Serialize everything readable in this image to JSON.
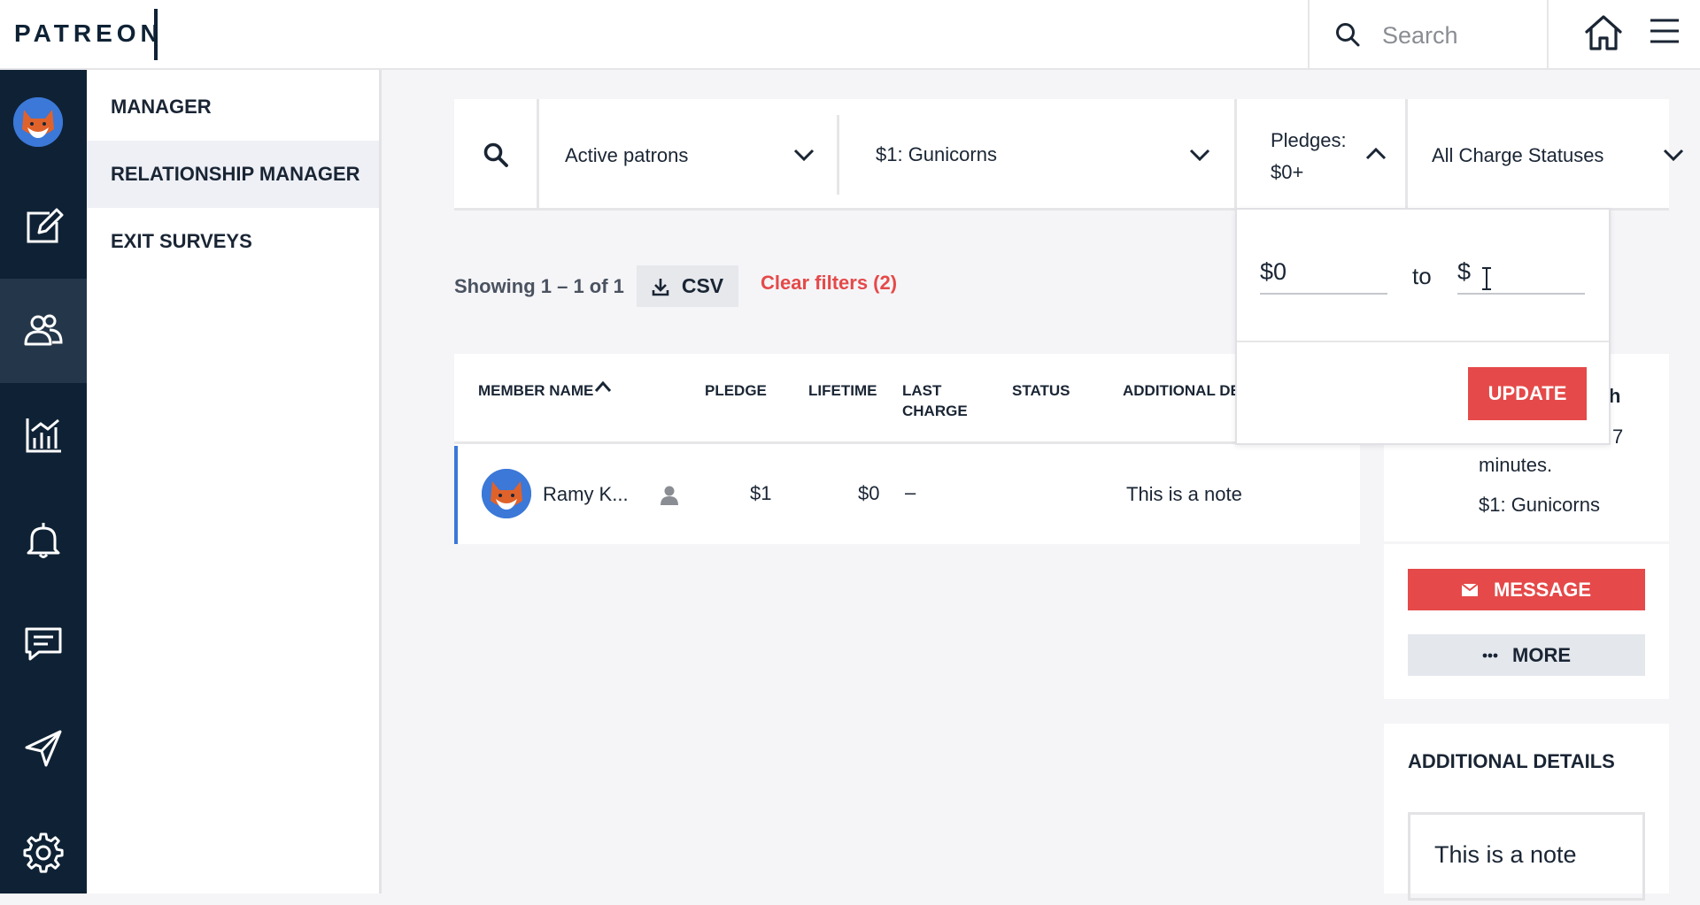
{
  "header": {
    "logo": "PATREON",
    "search_placeholder": "Search"
  },
  "subnav": {
    "items": [
      {
        "label": "MANAGER"
      },
      {
        "label": "RELATIONSHIP MANAGER"
      },
      {
        "label": "EXIT SURVEYS"
      }
    ]
  },
  "filters": {
    "status": "Active patrons",
    "tier": "$1: Gunicorns",
    "pledges_line1": "Pledges:",
    "pledges_line2": "$0+",
    "charge_status": "All Charge Statuses"
  },
  "pledge_dropdown": {
    "min_value": "$0",
    "to_label": "to",
    "max_value": "$",
    "update_label": "UPDATE"
  },
  "results": {
    "showing": "Showing 1 – 1 of 1",
    "csv_label": "CSV",
    "clear_filters": "Clear filters (2)"
  },
  "table": {
    "columns": {
      "member_name": "MEMBER NAME",
      "pledge": "PLEDGE",
      "lifetime": "LIFETIME",
      "last_charge_1": "LAST",
      "last_charge_2": "CHARGE",
      "status": "STATUS",
      "additional": "ADDITIONAL DE"
    },
    "rows": [
      {
        "name": "Ramy K...",
        "pledge": "$1",
        "lifetime": "$0",
        "last_charge": "–",
        "status": "",
        "note": "This is a note"
      }
    ]
  },
  "side_panel": {
    "heading_fragment": "h",
    "time_fragment": "7",
    "time_suffix": "minutes.",
    "tier": "$1: Gunicorns",
    "message_label": "MESSAGE",
    "more_label": "MORE",
    "details_title": "ADDITIONAL DETAILS",
    "note": "This is a note"
  },
  "colors": {
    "rail": "#0f2235",
    "accent_red": "#e54949",
    "accent_blue": "#3b78d8",
    "fox_orange": "#e0622b"
  }
}
